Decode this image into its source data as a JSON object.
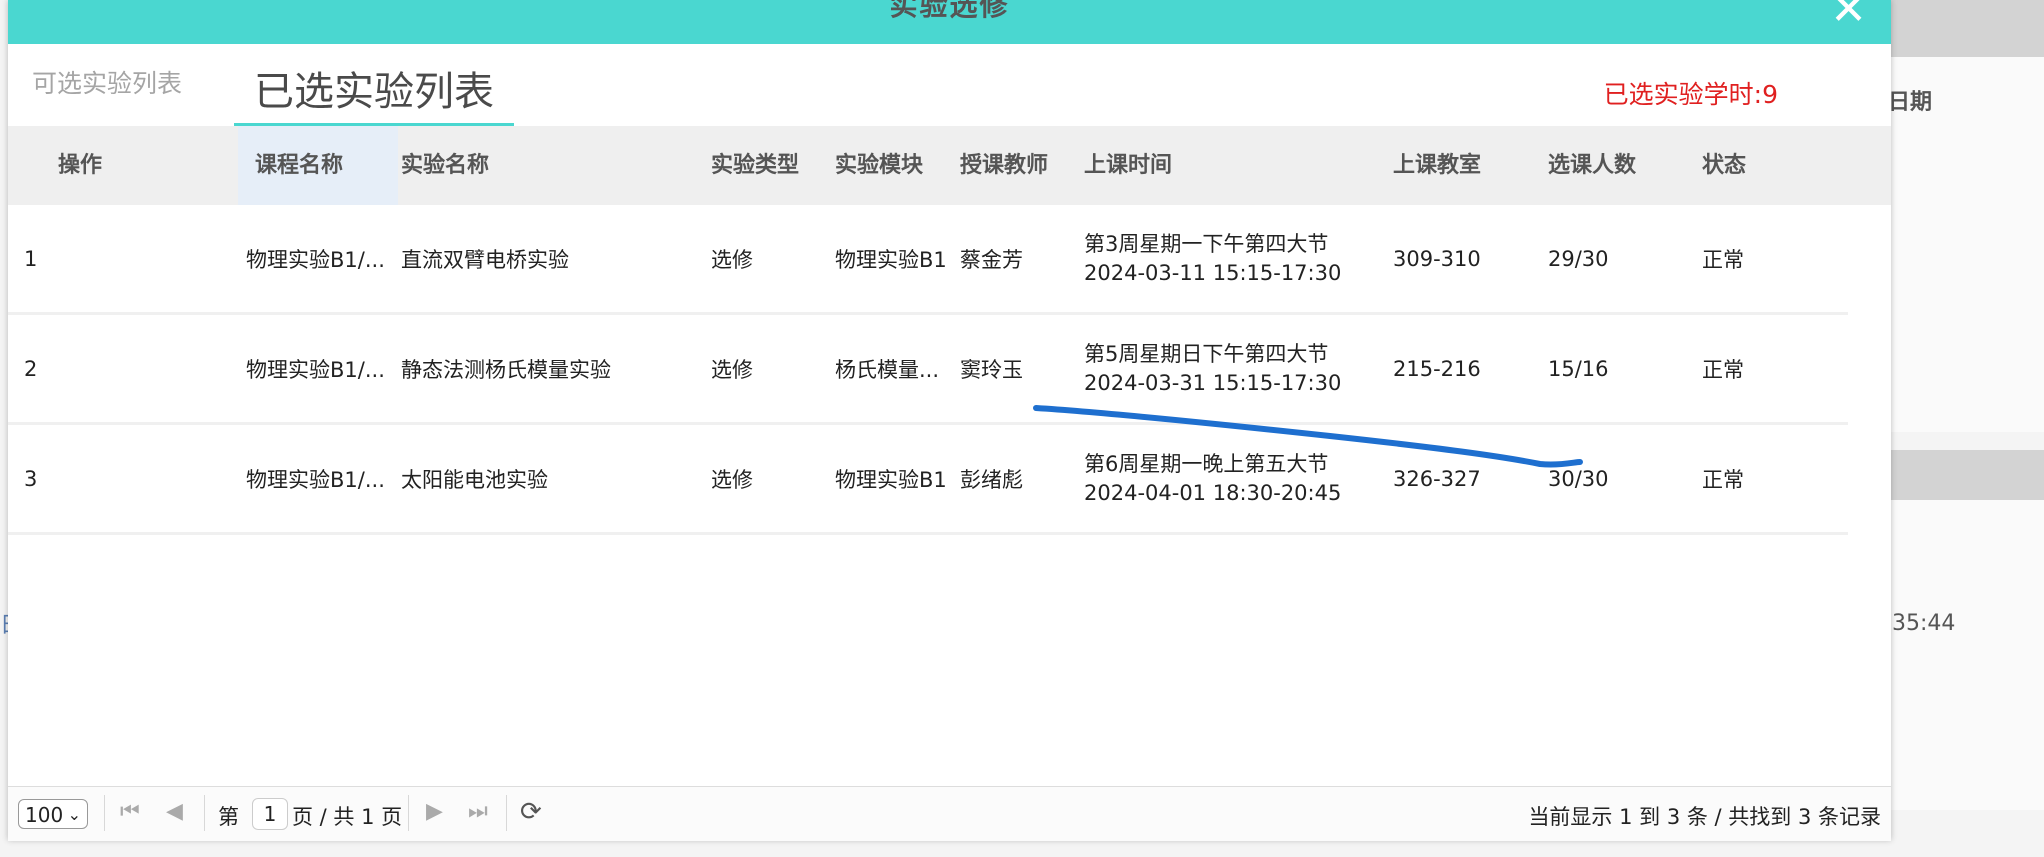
{
  "background": {
    "date_header": "日期",
    "time_fragment": "35:44",
    "left_fragment": "日"
  },
  "modal": {
    "title": "实验选修",
    "close_icon": "close-icon"
  },
  "tabs": {
    "available": "可选实验列表",
    "selected": "已选实验列表"
  },
  "selected_hours": "已选实验学时:9",
  "table": {
    "columns": [
      "操作",
      "课程名称",
      "实验名称",
      "实验类型",
      "实验模块",
      "授课教师",
      "上课时间",
      "上课教室",
      "选课人数",
      "状态"
    ],
    "rows": [
      {
        "op": "1",
        "course": "物理实验B1/...",
        "experiment": "直流双臂电桥实验",
        "type": "选修",
        "module": "物理实验B1",
        "teacher": "蔡金芳",
        "time_line1": "第3周星期一下午第四大节",
        "time_line2": "2024-03-11 15:15-17:30",
        "room": "309-310",
        "enrolled": "29/30",
        "status": "正常"
      },
      {
        "op": "2",
        "course": "物理实验B1/...",
        "experiment": "静态法测杨氏模量实验",
        "type": "选修",
        "module": "杨氏模量...",
        "teacher": "窦玲玉",
        "time_line1": "第5周星期日下午第四大节",
        "time_line2": "2024-03-31 15:15-17:30",
        "room": "215-216",
        "enrolled": "15/16",
        "status": "正常"
      },
      {
        "op": "3",
        "course": "物理实验B1/...",
        "experiment": "太阳能电池实验",
        "type": "选修",
        "module": "物理实验B1",
        "teacher": "彭绪彪",
        "time_line1": "第6周星期一晚上第五大节",
        "time_line2": "2024-04-01 18:30-20:45",
        "room": "326-327",
        "enrolled": "30/30",
        "status": "正常"
      }
    ]
  },
  "pagination": {
    "page_size": "100",
    "page_prefix": "第",
    "current_page": "1",
    "page_suffix": "页 / 共 1 页",
    "record_info": "当前显示 1 到 3 条 / 共找到 3 条记录"
  },
  "colors": {
    "header": "#4ad7d0",
    "hours_text": "#e02020",
    "annotation_stroke": "#1e6fcf"
  }
}
